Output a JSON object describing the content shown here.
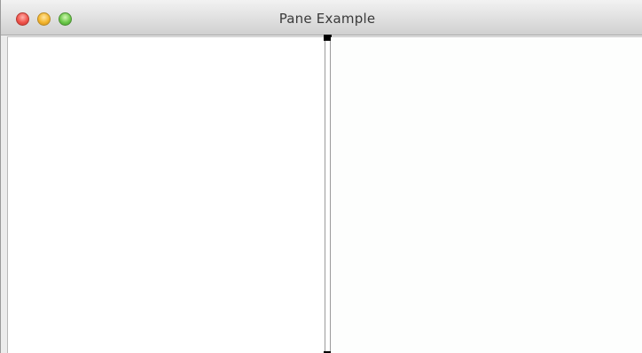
{
  "window": {
    "title": "Pane Example"
  },
  "traffic_lights": [
    {
      "name": "close",
      "color": "#f0544c"
    },
    {
      "name": "minimize",
      "color": "#f4b62d"
    },
    {
      "name": "zoom",
      "color": "#6cc94a"
    }
  ],
  "split_pane": {
    "orientation": "horizontal",
    "divider_color": "#9b9b9b",
    "left_pane_background": "#ffffff",
    "right_pane_background": "#fdfefd"
  }
}
